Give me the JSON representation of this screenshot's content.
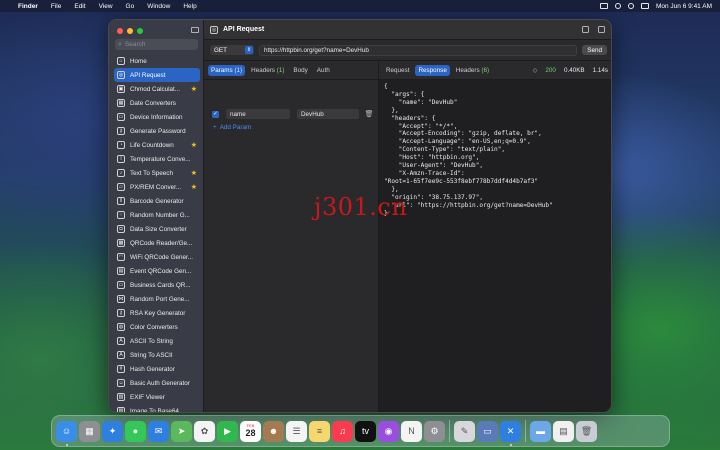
{
  "menubar": {
    "app": "Finder",
    "menus": [
      "File",
      "Edit",
      "View",
      "Go",
      "Window",
      "Help"
    ],
    "datetime": "Mon Jun 6  9:41 AM"
  },
  "window": {
    "title": "API Request"
  },
  "sidebar": {
    "search_placeholder": "Search",
    "items": [
      {
        "label": "Home",
        "icon": "house-icon",
        "star": false
      },
      {
        "label": "API Request",
        "icon": "globe-icon",
        "star": false,
        "active": true
      },
      {
        "label": "Chmod Calculat...",
        "icon": "lock-icon",
        "star": true
      },
      {
        "label": "Date Converters",
        "icon": "calendar-icon",
        "star": false
      },
      {
        "label": "Device Information",
        "icon": "monitor-icon",
        "star": false
      },
      {
        "label": "Generate Password",
        "icon": "key-icon",
        "star": false
      },
      {
        "label": "Life Countdown",
        "icon": "clock-icon",
        "star": true
      },
      {
        "label": "Temperature Conve...",
        "icon": "thermometer-icon",
        "star": false
      },
      {
        "label": "Text To Speech",
        "icon": "speaker-icon",
        "star": true
      },
      {
        "label": "PX/REM Conver...",
        "icon": "ruler-icon",
        "star": true
      },
      {
        "label": "Barcode Generator",
        "icon": "barcode-icon",
        "star": false
      },
      {
        "label": "Random Number G...",
        "icon": "dice-icon",
        "star": false
      },
      {
        "label": "Data Size Converter",
        "icon": "disk-icon",
        "star": false
      },
      {
        "label": "QRCode Reader/Ge...",
        "icon": "qrcode-icon",
        "star": false
      },
      {
        "label": "WiFi QRCode Gener...",
        "icon": "wifi-icon",
        "star": false
      },
      {
        "label": "Event QRCode Gen...",
        "icon": "event-icon",
        "star": false
      },
      {
        "label": "Business Cards QR...",
        "icon": "card-icon",
        "star": false
      },
      {
        "label": "Random Port Gene...",
        "icon": "network-icon",
        "star": false
      },
      {
        "label": "RSA Key Generator",
        "icon": "key-icon",
        "star": false
      },
      {
        "label": "Color Converters",
        "icon": "palette-icon",
        "star": false
      },
      {
        "label": "ASCII To String",
        "icon": "text-icon",
        "star": false
      },
      {
        "label": "String To ASCII",
        "icon": "text-icon",
        "star": false
      },
      {
        "label": "Hash Generator",
        "icon": "hash-icon",
        "star": false
      },
      {
        "label": "Basic Auth Generator",
        "icon": "person-icon",
        "star": false
      },
      {
        "label": "EXIF Viewer",
        "icon": "photo-icon",
        "star": false
      },
      {
        "label": "Image To Base64",
        "icon": "image-icon",
        "star": false
      }
    ]
  },
  "request": {
    "method": "GET",
    "url": "https://httpbin.org/get?name=DevHub",
    "send_label": "Send",
    "tabs": [
      {
        "label": "Params",
        "count": "(1)",
        "active": true
      },
      {
        "label": "Headers",
        "count": "(1)",
        "active": false
      },
      {
        "label": "Body",
        "count": "",
        "active": false
      },
      {
        "label": "Auth",
        "count": "",
        "active": false
      }
    ],
    "params": [
      {
        "key": "name",
        "value": "DevHub",
        "enabled": true
      }
    ],
    "add_param_label": "Add Param"
  },
  "response": {
    "tabs": [
      {
        "label": "Request",
        "count": "",
        "active": false
      },
      {
        "label": "Response",
        "count": "",
        "active": true
      },
      {
        "label": "Headers",
        "count": "(6)",
        "active": false
      }
    ],
    "status": "200",
    "size": "0.40KB",
    "time": "1.14s",
    "body": "{\n  \"args\": {\n    \"name\": \"DevHub\"\n  },\n  \"headers\": {\n    \"Accept\": \"*/*\",\n    \"Accept-Encoding\": \"gzip, deflate, br\",\n    \"Accept-Language\": \"en-US,en;q=0.9\",\n    \"Content-Type\": \"text/plain\",\n    \"Host\": \"httpbin.org\",\n    \"User-Agent\": \"DevHub\",\n    \"X-Amzn-Trace-Id\":\n\"Root=1-65f7ee9c-553f8ebf778b7ddf4d4b7af3\"\n  },\n  \"origin\": \"38.75.137.97\",\n  \"url\": \"https://httpbin.org/get?name=DevHub\"\n}"
  },
  "watermark": "j301.cn",
  "dock": {
    "calendar": {
      "month": "FEB",
      "day": "28"
    },
    "apps": [
      {
        "name": "finder-icon",
        "color": "#3a8ee8",
        "glyph": "☺",
        "running": true
      },
      {
        "name": "launchpad-icon",
        "color": "#8e8e93",
        "glyph": "▦",
        "running": false
      },
      {
        "name": "safari-icon",
        "color": "#2f7fe0",
        "glyph": "✦",
        "running": false
      },
      {
        "name": "messages-icon",
        "color": "#34c759",
        "glyph": "●",
        "running": false
      },
      {
        "name": "mail-icon",
        "color": "#2f7fe0",
        "glyph": "✉",
        "running": false
      },
      {
        "name": "maps-icon",
        "color": "#5bb85c",
        "glyph": "➤",
        "running": false
      },
      {
        "name": "photos-icon",
        "color": "#f4f4f4",
        "glyph": "✿",
        "running": false
      },
      {
        "name": "facetime-icon",
        "color": "#30b84f",
        "glyph": "▶",
        "running": false
      },
      {
        "name": "calendar-icon",
        "color": "#ffffff",
        "glyph": "",
        "running": false
      },
      {
        "name": "contacts-icon",
        "color": "#a57a52",
        "glyph": "☻",
        "running": false
      },
      {
        "name": "reminders-icon",
        "color": "#f4f4f4",
        "glyph": "☰",
        "running": false
      },
      {
        "name": "notes-icon",
        "color": "#f5d76e",
        "glyph": "≡",
        "running": false
      },
      {
        "name": "music-icon",
        "color": "#fa3b4f",
        "glyph": "♫",
        "running": false
      },
      {
        "name": "tv-icon",
        "color": "#111111",
        "glyph": "tv",
        "running": false
      },
      {
        "name": "podcasts-icon",
        "color": "#9a4ee0",
        "glyph": "◉",
        "running": false
      },
      {
        "name": "news-icon",
        "color": "#f4f4f4",
        "glyph": "N",
        "running": false
      },
      {
        "name": "app-store-icon",
        "color": "#8e8e93",
        "glyph": "⚙",
        "running": false
      },
      {
        "name": "sep",
        "color": "",
        "glyph": "",
        "running": false
      },
      {
        "name": "script-editor-icon",
        "color": "#d8d8dc",
        "glyph": "✎",
        "running": false
      },
      {
        "name": "preview-icon",
        "color": "#5a7ab8",
        "glyph": "▭",
        "running": false
      },
      {
        "name": "devhub-icon",
        "color": "#2f7fe0",
        "glyph": "✕",
        "running": true
      },
      {
        "name": "sep",
        "color": "",
        "glyph": "",
        "running": false
      },
      {
        "name": "downloads-folder-icon",
        "color": "#6aa8e8",
        "glyph": "▬",
        "running": false
      },
      {
        "name": "document-icon",
        "color": "#f0f0f0",
        "glyph": "▤",
        "running": false
      },
      {
        "name": "trash-icon",
        "color": "#c8ccd4",
        "glyph": "🗑",
        "running": false
      }
    ]
  }
}
